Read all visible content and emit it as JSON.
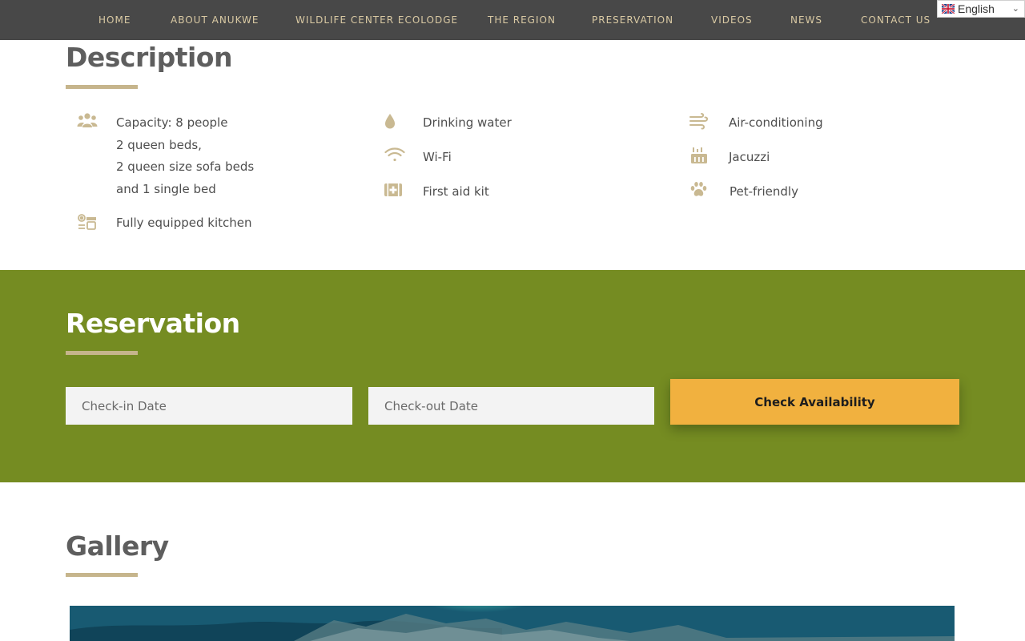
{
  "nav": {
    "items": [
      {
        "label": "HOME"
      },
      {
        "label": "ABOUT ANUKWE"
      },
      {
        "label": "WILDLIFE CENTER ECOLODGE"
      },
      {
        "label": "THE REGION"
      },
      {
        "label": "PRESERVATION"
      },
      {
        "label": "VIDEOS"
      },
      {
        "label": "NEWS"
      },
      {
        "label": "CONTACT US"
      }
    ],
    "language": "English"
  },
  "description": {
    "title": "Description",
    "features": [
      {
        "icon": "people-icon",
        "lines": [
          "Capacity: 8 people",
          "2 queen beds,",
          "2 queen size sofa beds",
          "and 1 single bed"
        ]
      },
      {
        "icon": "kitchen-icon",
        "lines": [
          "Fully equipped kitchen"
        ]
      },
      {
        "icon": "water-drop-icon",
        "lines": [
          "Drinking water"
        ]
      },
      {
        "icon": "wifi-icon",
        "lines": [
          "Wi-Fi"
        ]
      },
      {
        "icon": "first-aid-icon",
        "lines": [
          "First aid kit"
        ]
      },
      {
        "icon": "air-conditioning-icon",
        "lines": [
          "Air-conditioning"
        ]
      },
      {
        "icon": "jacuzzi-icon",
        "lines": [
          "Jacuzzi"
        ]
      },
      {
        "icon": "paw-icon",
        "lines": [
          "Pet-friendly"
        ]
      }
    ]
  },
  "reservation": {
    "title": "Reservation",
    "checkin_placeholder": "Check-in Date",
    "checkout_placeholder": "Check-out Date",
    "button_label": "Check Availability"
  },
  "gallery": {
    "title": "Gallery"
  },
  "colors": {
    "nav_bg": "#484848",
    "nav_text": "#d9c9a3",
    "accent_underline": "#c6b58c",
    "icon_tan": "#c9b992",
    "reservation_bg": "#758c22",
    "button_bg": "#f1b13f"
  }
}
